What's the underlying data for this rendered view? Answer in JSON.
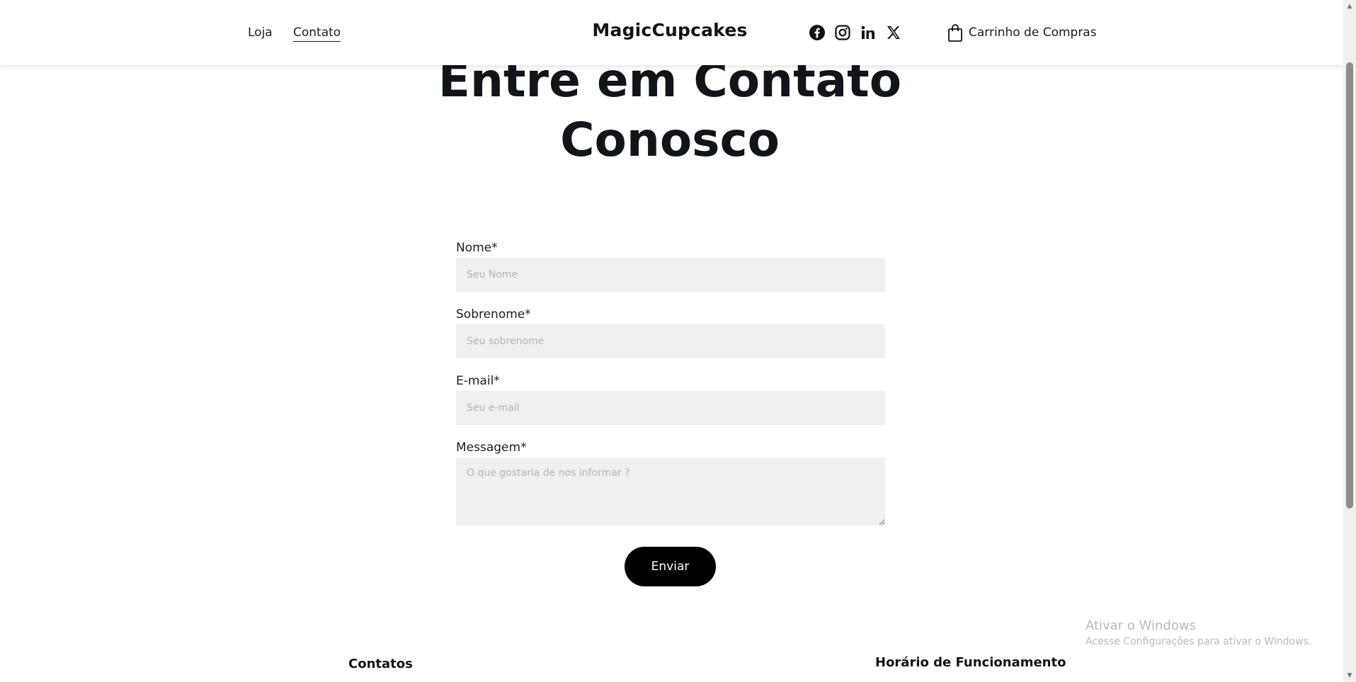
{
  "header": {
    "nav": [
      {
        "label": "Loja",
        "active": false
      },
      {
        "label": "Contato",
        "active": true
      }
    ],
    "brand": "MagicCupcakes",
    "social_icons": [
      "facebook-icon",
      "instagram-icon",
      "linkedin-icon",
      "x-icon"
    ],
    "cart_label": "Carrinho de Compras"
  },
  "hero": {
    "title_line1": "Entre em Contato",
    "title_line2": "Conosco"
  },
  "form": {
    "fields": [
      {
        "label": "Nome*",
        "placeholder": "Seu Nome",
        "value": ""
      },
      {
        "label": "Sobrenome*",
        "placeholder": "Seu sobrenome",
        "value": ""
      },
      {
        "label": "E-mail*",
        "placeholder": "Seu e-mail",
        "value": ""
      },
      {
        "label": "Messagem*",
        "placeholder": "O que gostaria de nos informar ?",
        "value": ""
      }
    ],
    "submit_label": "Enviar"
  },
  "footer": {
    "contacts_heading": "Contatos",
    "hours_heading": "Horário de Funcionamento"
  },
  "watermark": {
    "title": "Ativar o Windows",
    "subtitle": "Acesse Configurações para ativar o Windows."
  },
  "colors": {
    "accent": "#000000",
    "text": "#111418",
    "input_bg": "#f0f0f0",
    "placeholder": "#b4b4b4"
  }
}
